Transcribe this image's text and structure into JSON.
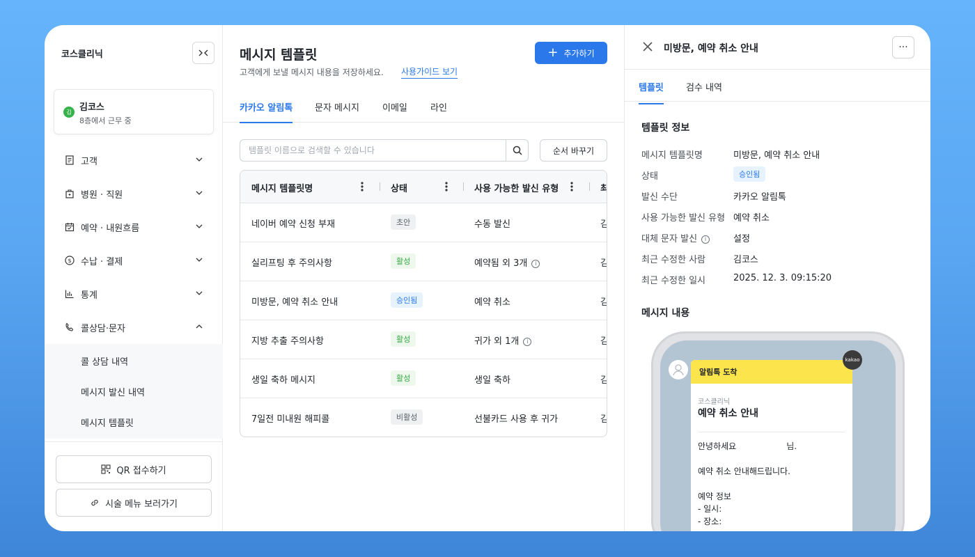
{
  "sidebar": {
    "brand": "코스클리닉",
    "user": {
      "initial": "김",
      "name": "김코스",
      "status": "8층에서 근무 중"
    },
    "nav": [
      {
        "label": "고객",
        "icon": "receipt-icon"
      },
      {
        "label": "병원 · 직원",
        "icon": "building-icon"
      },
      {
        "label": "예약 · 내원흐름",
        "icon": "calendar-icon"
      },
      {
        "label": "수납 · 결제",
        "icon": "dollar-icon"
      },
      {
        "label": "통계",
        "icon": "chart-icon"
      },
      {
        "label": "콜상담·문자",
        "icon": "phone-icon"
      }
    ],
    "subnav": [
      "콜 상담 내역",
      "메시지 발신 내역",
      "메시지 템플릿"
    ],
    "qr_button": "QR 접수하기",
    "menu_button": "시술 메뉴 보러가기"
  },
  "main": {
    "title": "메시지 템플릿",
    "description": "고객에게 보낼 메시지 내용을 저장하세요.",
    "guide_link": "사용가이드 보기",
    "add_button": "추가하기",
    "tabs": [
      "카카오 알림톡",
      "문자 메시지",
      "이메일",
      "라인"
    ],
    "search_placeholder": "템플릿 이름으로 검색할 수 있습니다",
    "order_button": "순서 바꾸기",
    "columns": [
      "메시지 템플릿명",
      "상태",
      "사용 가능한 발신 유형",
      "최"
    ],
    "rows": [
      {
        "name": "네이버 예약 신청 부재",
        "status": "초안",
        "type": "수동 발신",
        "last": "김"
      },
      {
        "name": "실리프팅 후 주의사항",
        "status": "활성",
        "type": "예약됨 외 3개",
        "last": "김"
      },
      {
        "name": "미방문, 예약 취소 안내",
        "status": "승인됨",
        "type": "예약 취소",
        "last": "김"
      },
      {
        "name": "지방 추출 주의사항",
        "status": "활성",
        "type": "귀가 외 1개",
        "last": "김"
      },
      {
        "name": "생일 축하 메시지",
        "status": "활성",
        "type": "생일 축하",
        "last": "김"
      },
      {
        "name": "7일전 미내원 해피콜",
        "status": "비활성",
        "type": "선불카드 사용 후 귀가",
        "last": "김"
      }
    ]
  },
  "panel": {
    "title": "미방문, 예약 취소 안내",
    "more": "···",
    "tabs": [
      "템플릿",
      "검수 내역"
    ],
    "info_title": "템플릿 정보",
    "info": [
      {
        "label": "메시지 템플릿명",
        "value": "미방문, 예약 취소 안내"
      },
      {
        "label": "상태",
        "value": "승인됨"
      },
      {
        "label": "발신 수단",
        "value": "카카오 알림톡"
      },
      {
        "label": "사용 가능한 발신 유형",
        "value": "예약 취소"
      },
      {
        "label": "대체 문자 발신",
        "value": "설정"
      },
      {
        "label": "최근 수정한 사람",
        "value": "김코스"
      },
      {
        "label": "최근 수정한 일시",
        "value": "2025. 12. 3. 09:15:20"
      }
    ],
    "content_title": "메시지 내용",
    "preview": {
      "header": "알림톡 도착",
      "kakao_badge": "kakao",
      "clinic": "코스클리닉",
      "title": "예약 취소 안내",
      "greeting_a": "안녕하세요",
      "greeting_b": "님.",
      "line1": "예약 취소 안내해드립니다.",
      "line2": "예약 정보",
      "line3": "- 일시:",
      "line4": "- 장소:"
    }
  },
  "colors": {
    "accent": "#2a78ea",
    "active": "#35a646",
    "kakao_yellow": "#fbe44c"
  }
}
